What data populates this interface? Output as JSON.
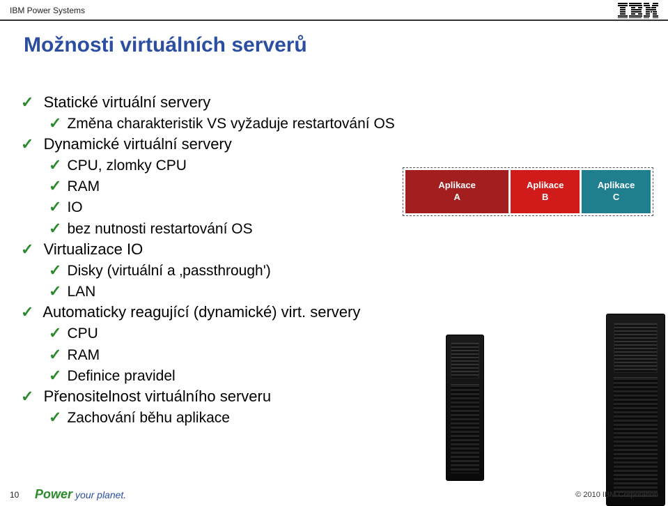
{
  "header": {
    "product_line": "IBM Power Systems"
  },
  "title": "Možnosti virtuálních serverů",
  "bullets": [
    {
      "text": "Statické virtuální servery",
      "children": [
        {
          "text": "Změna charakteristik VS vyžaduje restartování OS"
        }
      ]
    },
    {
      "text": "Dynamické virtuální servery",
      "children": [
        {
          "text": "CPU, zlomky CPU"
        },
        {
          "text": "RAM"
        },
        {
          "text": "IO"
        },
        {
          "text": "bez nutnosti restartování OS"
        }
      ]
    },
    {
      "text": "Virtualizace IO",
      "children": [
        {
          "text": "Disky (virtuální a ‚passthrough')"
        },
        {
          "text": "LAN"
        }
      ]
    },
    {
      "text": "Automaticky reagující (dynamické) virt. servery",
      "children": [
        {
          "text": "CPU"
        },
        {
          "text": "RAM"
        },
        {
          "text": "Definice pravidel"
        }
      ]
    },
    {
      "text": "Přenositelnost virtuálního serveru",
      "children": [
        {
          "text": "Zachování běhu aplikace"
        }
      ]
    }
  ],
  "apps": {
    "label": "Aplikace",
    "items": [
      {
        "name": "A",
        "color": "#a31f1f"
      },
      {
        "name": "B",
        "color": "#d11b1b"
      },
      {
        "name": "C",
        "color": "#1f7f8f"
      }
    ]
  },
  "footer": {
    "page": "10",
    "power1": "Power",
    "power2": "your planet.",
    "copyright": "© 2010 IBM Corporation"
  }
}
